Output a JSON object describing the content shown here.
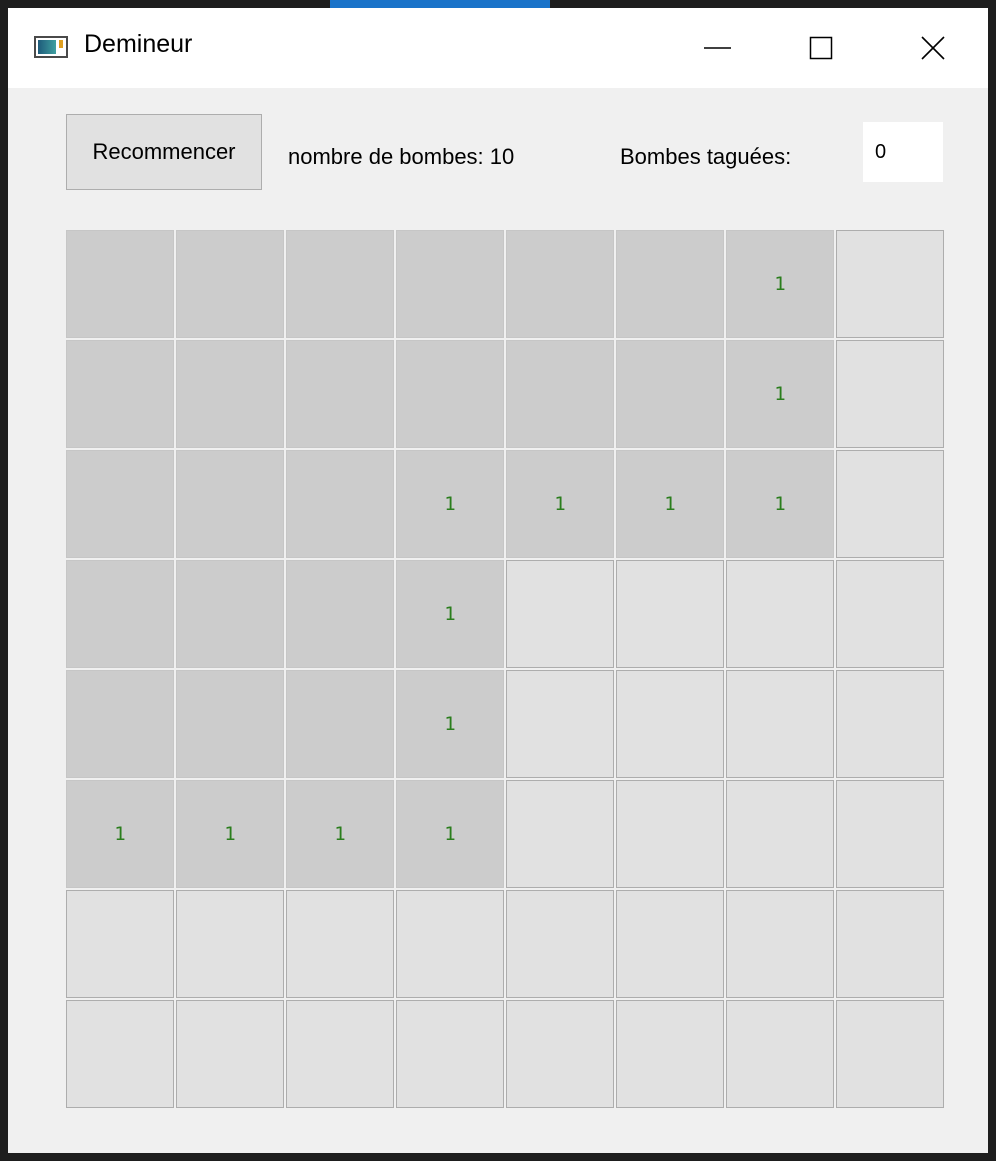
{
  "window": {
    "title": "Demineur"
  },
  "toolbar": {
    "restart_label": "Recommencer",
    "bomb_count_label": "nombre de bombes: 10",
    "tagged_label": "Bombes taguées:",
    "tagged_value": "0"
  },
  "colors": {
    "number_color": "#2a7d1c",
    "revealed_cell": "#cccccc",
    "hidden_cell": "#e1e1e1"
  },
  "board": {
    "rows": 8,
    "cols": 8,
    "cells": [
      [
        "r",
        "r",
        "r",
        "r",
        "r",
        "r",
        "1",
        "h"
      ],
      [
        "r",
        "r",
        "r",
        "r",
        "r",
        "r",
        "1",
        "h"
      ],
      [
        "r",
        "r",
        "r",
        "1",
        "1",
        "1",
        "1",
        "h"
      ],
      [
        "r",
        "r",
        "r",
        "1",
        "h",
        "h",
        "h",
        "h"
      ],
      [
        "r",
        "r",
        "r",
        "1",
        "h",
        "h",
        "h",
        "h"
      ],
      [
        "1",
        "1",
        "1",
        "1",
        "h",
        "h",
        "h",
        "h"
      ],
      [
        "h",
        "h",
        "h",
        "h",
        "h",
        "h",
        "h",
        "h"
      ],
      [
        "h",
        "h",
        "h",
        "h",
        "h",
        "h",
        "h",
        "h"
      ]
    ]
  }
}
